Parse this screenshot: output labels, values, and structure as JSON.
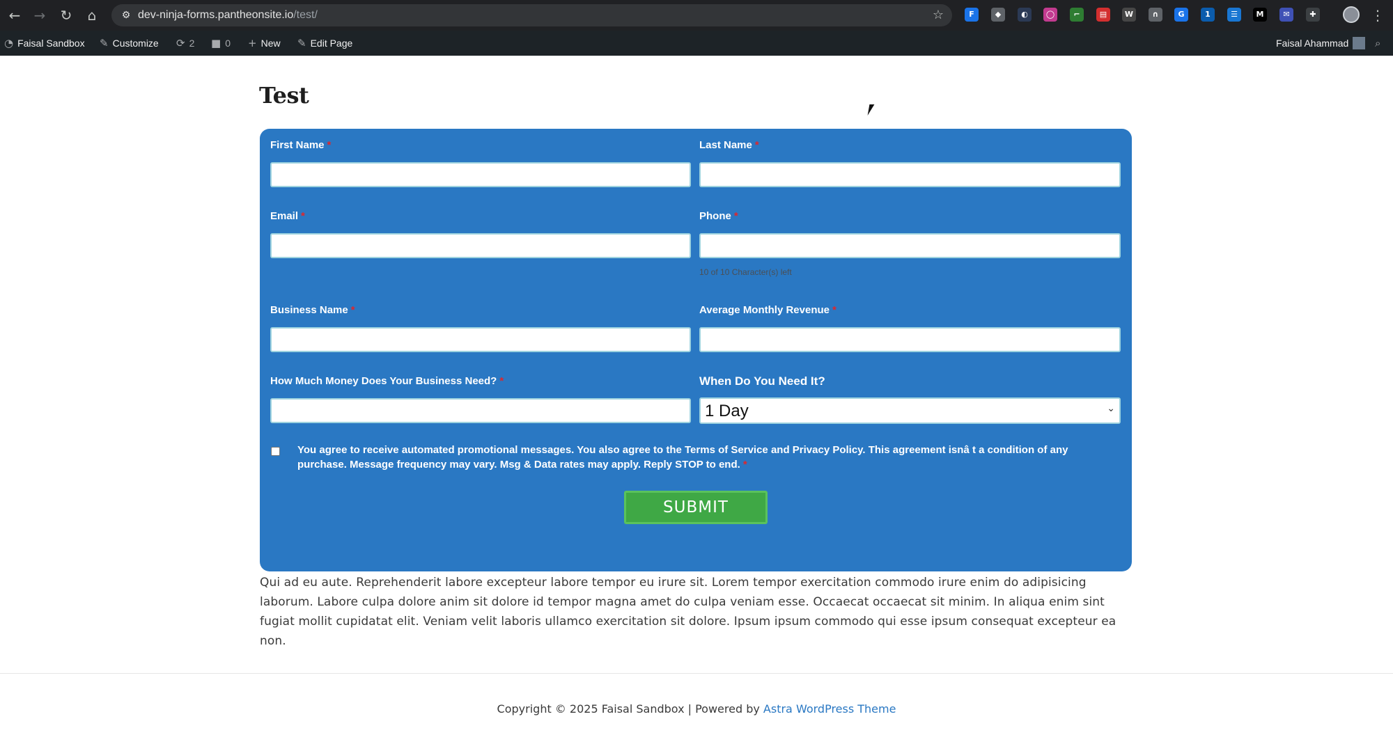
{
  "browser": {
    "url_host": "dev-ninja-forms.pantheonsite.io",
    "url_path": "/test/",
    "nav": {
      "back_icon": "back-arrow-icon",
      "forward_icon": "forward-arrow-icon",
      "reload_icon": "reload-icon",
      "home_icon": "home-icon"
    },
    "extensions": [
      {
        "icon": "flow-extension-icon",
        "glyph": "F",
        "color": "#1a73e8"
      },
      {
        "icon": "shield-extension-icon",
        "glyph": "◆",
        "color": "#5f6368"
      },
      {
        "icon": "moon-extension-icon",
        "glyph": "◐",
        "color": "#2b3a55"
      },
      {
        "icon": "ring-extension-icon",
        "glyph": "◯",
        "color": "#c23b8f"
      },
      {
        "icon": "leaf-extension-icon",
        "glyph": "⌐",
        "color": "#2e7d32"
      },
      {
        "icon": "table-extension-icon",
        "glyph": "▤",
        "color": "#d32f2f"
      },
      {
        "icon": "wordpress-extension-icon",
        "glyph": "W",
        "color": "#464646"
      },
      {
        "icon": "arc-extension-icon",
        "glyph": "∩",
        "color": "#5f6368"
      },
      {
        "icon": "translate-extension-icon",
        "glyph": "G",
        "color": "#1a73e8"
      },
      {
        "icon": "onepassword-extension-icon",
        "glyph": "1",
        "color": "#0b5cad"
      },
      {
        "icon": "form-extension-icon",
        "glyph": "☰",
        "color": "#1976d2"
      },
      {
        "icon": "medium-extension-icon",
        "glyph": "M",
        "color": "#000000"
      },
      {
        "icon": "mail-extension-icon",
        "glyph": "✉",
        "color": "#3f51b5"
      },
      {
        "icon": "puzzle-extensions-icon",
        "glyph": "✚",
        "color": "#3c4043"
      }
    ]
  },
  "admin_bar": {
    "site_name": "Faisal Sandbox",
    "customize": "Customize",
    "updates_count": "2",
    "comments_count": "0",
    "new_label": "New",
    "edit_label": "Edit Page",
    "user_name": "Faisal Ahammad"
  },
  "page": {
    "title": "Test"
  },
  "form": {
    "required_mark": "*",
    "first_name_label": "First Name",
    "last_name_label": "Last Name",
    "email_label": "Email",
    "phone_label": "Phone",
    "phone_char_count": "10 of 10 Character(s) left",
    "business_name_label": "Business Name",
    "revenue_label": "Average Monthly Revenue",
    "money_label": "How Much Money Does Your Business Need?",
    "when_label": "When Do You Need It?",
    "when_selected": "1 Day",
    "consent_text": "You agree to receive automated promotional messages. You also agree to the Terms of Service and Privacy Policy. This agreement isnâ  t a condition of any purchase. Message frequency may vary. Msg & Data rates may apply. Reply STOP to end.",
    "submit_label": "SUBMIT"
  },
  "content": {
    "paragraph": "Qui ad eu aute. Reprehenderit labore excepteur labore tempor eu irure sit. Lorem tempor exercitation commodo irure enim do adipisicing laborum. Labore culpa dolore anim sit dolore id tempor magna amet do culpa veniam esse. Occaecat occaecat sit minim. In aliqua enim sint fugiat mollit cupidatat elit. Veniam velit laboris ullamco exercitation sit dolore. Ipsum ipsum commodo qui esse ipsum consequat excepteur ea non."
  },
  "footer": {
    "copyright": "Copyright © 2025 Faisal Sandbox | Powered by ",
    "theme_link": "Astra WordPress Theme"
  },
  "colors": {
    "form_background": "#2a78c3",
    "submit_background": "#3fa845",
    "required": "#e0262a",
    "admin_bar": "#1d2327"
  }
}
